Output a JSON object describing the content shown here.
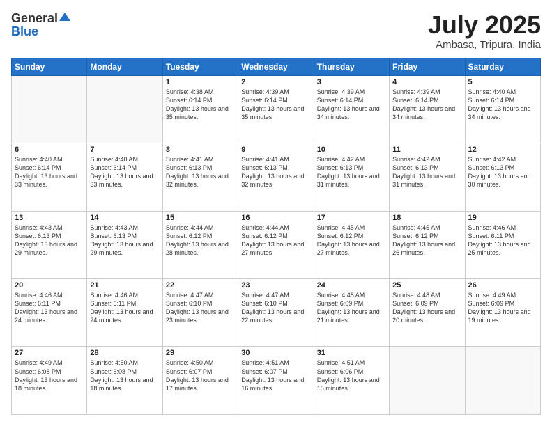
{
  "header": {
    "logo_general": "General",
    "logo_blue": "Blue",
    "title": "July 2025",
    "location": "Ambasa, Tripura, India"
  },
  "weekdays": [
    "Sunday",
    "Monday",
    "Tuesday",
    "Wednesday",
    "Thursday",
    "Friday",
    "Saturday"
  ],
  "weeks": [
    [
      {
        "day": "",
        "info": ""
      },
      {
        "day": "",
        "info": ""
      },
      {
        "day": "1",
        "info": "Sunrise: 4:38 AM\nSunset: 6:14 PM\nDaylight: 13 hours and 35 minutes."
      },
      {
        "day": "2",
        "info": "Sunrise: 4:39 AM\nSunset: 6:14 PM\nDaylight: 13 hours and 35 minutes."
      },
      {
        "day": "3",
        "info": "Sunrise: 4:39 AM\nSunset: 6:14 PM\nDaylight: 13 hours and 34 minutes."
      },
      {
        "day": "4",
        "info": "Sunrise: 4:39 AM\nSunset: 6:14 PM\nDaylight: 13 hours and 34 minutes."
      },
      {
        "day": "5",
        "info": "Sunrise: 4:40 AM\nSunset: 6:14 PM\nDaylight: 13 hours and 34 minutes."
      }
    ],
    [
      {
        "day": "6",
        "info": "Sunrise: 4:40 AM\nSunset: 6:14 PM\nDaylight: 13 hours and 33 minutes."
      },
      {
        "day": "7",
        "info": "Sunrise: 4:40 AM\nSunset: 6:14 PM\nDaylight: 13 hours and 33 minutes."
      },
      {
        "day": "8",
        "info": "Sunrise: 4:41 AM\nSunset: 6:13 PM\nDaylight: 13 hours and 32 minutes."
      },
      {
        "day": "9",
        "info": "Sunrise: 4:41 AM\nSunset: 6:13 PM\nDaylight: 13 hours and 32 minutes."
      },
      {
        "day": "10",
        "info": "Sunrise: 4:42 AM\nSunset: 6:13 PM\nDaylight: 13 hours and 31 minutes."
      },
      {
        "day": "11",
        "info": "Sunrise: 4:42 AM\nSunset: 6:13 PM\nDaylight: 13 hours and 31 minutes."
      },
      {
        "day": "12",
        "info": "Sunrise: 4:42 AM\nSunset: 6:13 PM\nDaylight: 13 hours and 30 minutes."
      }
    ],
    [
      {
        "day": "13",
        "info": "Sunrise: 4:43 AM\nSunset: 6:13 PM\nDaylight: 13 hours and 29 minutes."
      },
      {
        "day": "14",
        "info": "Sunrise: 4:43 AM\nSunset: 6:13 PM\nDaylight: 13 hours and 29 minutes."
      },
      {
        "day": "15",
        "info": "Sunrise: 4:44 AM\nSunset: 6:12 PM\nDaylight: 13 hours and 28 minutes."
      },
      {
        "day": "16",
        "info": "Sunrise: 4:44 AM\nSunset: 6:12 PM\nDaylight: 13 hours and 27 minutes."
      },
      {
        "day": "17",
        "info": "Sunrise: 4:45 AM\nSunset: 6:12 PM\nDaylight: 13 hours and 27 minutes."
      },
      {
        "day": "18",
        "info": "Sunrise: 4:45 AM\nSunset: 6:12 PM\nDaylight: 13 hours and 26 minutes."
      },
      {
        "day": "19",
        "info": "Sunrise: 4:46 AM\nSunset: 6:11 PM\nDaylight: 13 hours and 25 minutes."
      }
    ],
    [
      {
        "day": "20",
        "info": "Sunrise: 4:46 AM\nSunset: 6:11 PM\nDaylight: 13 hours and 24 minutes."
      },
      {
        "day": "21",
        "info": "Sunrise: 4:46 AM\nSunset: 6:11 PM\nDaylight: 13 hours and 24 minutes."
      },
      {
        "day": "22",
        "info": "Sunrise: 4:47 AM\nSunset: 6:10 PM\nDaylight: 13 hours and 23 minutes."
      },
      {
        "day": "23",
        "info": "Sunrise: 4:47 AM\nSunset: 6:10 PM\nDaylight: 13 hours and 22 minutes."
      },
      {
        "day": "24",
        "info": "Sunrise: 4:48 AM\nSunset: 6:09 PM\nDaylight: 13 hours and 21 minutes."
      },
      {
        "day": "25",
        "info": "Sunrise: 4:48 AM\nSunset: 6:09 PM\nDaylight: 13 hours and 20 minutes."
      },
      {
        "day": "26",
        "info": "Sunrise: 4:49 AM\nSunset: 6:09 PM\nDaylight: 13 hours and 19 minutes."
      }
    ],
    [
      {
        "day": "27",
        "info": "Sunrise: 4:49 AM\nSunset: 6:08 PM\nDaylight: 13 hours and 18 minutes."
      },
      {
        "day": "28",
        "info": "Sunrise: 4:50 AM\nSunset: 6:08 PM\nDaylight: 13 hours and 18 minutes."
      },
      {
        "day": "29",
        "info": "Sunrise: 4:50 AM\nSunset: 6:07 PM\nDaylight: 13 hours and 17 minutes."
      },
      {
        "day": "30",
        "info": "Sunrise: 4:51 AM\nSunset: 6:07 PM\nDaylight: 13 hours and 16 minutes."
      },
      {
        "day": "31",
        "info": "Sunrise: 4:51 AM\nSunset: 6:06 PM\nDaylight: 13 hours and 15 minutes."
      },
      {
        "day": "",
        "info": ""
      },
      {
        "day": "",
        "info": ""
      }
    ]
  ]
}
